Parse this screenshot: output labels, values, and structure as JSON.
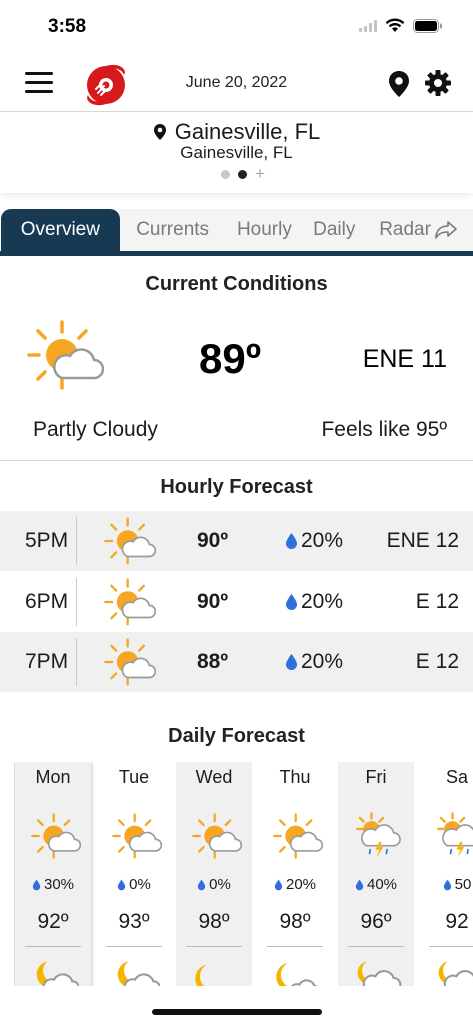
{
  "status_bar": {
    "time": "3:58"
  },
  "header": {
    "date": "June 20, 2022"
  },
  "location": {
    "name": "Gainesville, FL",
    "subname": "Gainesville, FL",
    "pages": 2,
    "active_page": 1
  },
  "tabs": [
    {
      "label": "Overview",
      "active": true
    },
    {
      "label": "Currents"
    },
    {
      "label": "Hourly"
    },
    {
      "label": "Daily"
    },
    {
      "label": "Radar"
    }
  ],
  "current": {
    "title": "Current Conditions",
    "temp": "89º",
    "wind": "ENE 11",
    "condition": "Partly Cloudy",
    "feels_like": "Feels like 95º",
    "icon": "partly-cloudy-day-icon"
  },
  "hourly": {
    "title": "Hourly Forecast",
    "rows": [
      {
        "time": "5PM",
        "temp": "90º",
        "precip": "20%",
        "wind": "ENE 12",
        "icon": "partly-cloudy-day-icon"
      },
      {
        "time": "6PM",
        "temp": "90º",
        "precip": "20%",
        "wind": "E 12",
        "icon": "partly-cloudy-day-icon"
      },
      {
        "time": "7PM",
        "temp": "88º",
        "precip": "20%",
        "wind": "E 12",
        "icon": "partly-cloudy-day-icon"
      }
    ]
  },
  "daily": {
    "title": "Daily Forecast",
    "days": [
      {
        "name": "Mon",
        "precip": "30%",
        "high": "92º",
        "icon": "partly-cloudy-day-icon",
        "night_icon": "partly-cloudy-night-icon"
      },
      {
        "name": "Tue",
        "precip": "0%",
        "high": "93º",
        "icon": "partly-cloudy-day-icon",
        "night_icon": "partly-cloudy-night-icon"
      },
      {
        "name": "Wed",
        "precip": "0%",
        "high": "98º",
        "icon": "partly-cloudy-day-icon",
        "night_icon": "moon-icon"
      },
      {
        "name": "Thu",
        "precip": "20%",
        "high": "98º",
        "icon": "partly-cloudy-day-icon",
        "night_icon": "moon-cloud-icon"
      },
      {
        "name": "Fri",
        "precip": "40%",
        "high": "96º",
        "icon": "thunderstorm-day-icon",
        "night_icon": "thunderstorm-night-icon"
      },
      {
        "name": "Sa",
        "precip": "50",
        "high": "92",
        "icon": "thunderstorm-day-icon",
        "night_icon": "thunderstorm-night-icon"
      }
    ]
  },
  "colors": {
    "tab_active": "#173a52",
    "sun": "#f5a623",
    "drop": "#2f6fde",
    "logo": "#d6191b"
  }
}
